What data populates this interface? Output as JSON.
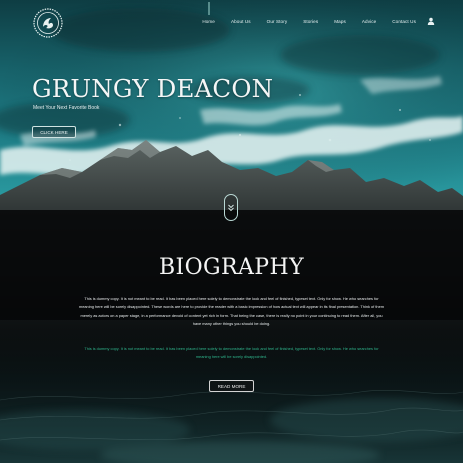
{
  "nav": {
    "items": [
      {
        "label": "Home",
        "active": true
      },
      {
        "label": "About Us"
      },
      {
        "label": "Our Story"
      },
      {
        "label": "Stories"
      },
      {
        "label": "Maps"
      },
      {
        "label": "Advice"
      },
      {
        "label": "Contact Us"
      }
    ],
    "user_icon": "user-icon"
  },
  "hero": {
    "title": "GRUNGY DEACON",
    "subtitle": "Meet Your Next Favorite Book",
    "button_label": "CLICK HERE"
  },
  "scroll_icon": "double-chevron-down-icon",
  "biography": {
    "title": "BIOGRAPHY",
    "paragraph1": "This is dummy copy. It is not meant to be read. It has been placed here solely to demonstrate the look and feel of finished, typeset text. Only for show. He who searches for meaning here will be sorely disappointed. These words are here to provide the reader with a basic impression of how actual text will appear in its final presentation. Think of them merely as actors on a paper stage, in a performance devoid of content yet rich in form. That being the case, there is really no point in your continuing to read them. After all, you have many other things you should be doing.",
    "paragraph2": "This is dummy copy. It is not meant to be read. It has been placed here solely to demonstrate the look and feel of finished, typeset text. Only for show. He who searches for meaning here will be sorely disappointed.",
    "button_label": "READ MORE"
  },
  "colors": {
    "accent_green": "#2fb58c",
    "ocean_teal": "#1f7d85",
    "dark": "#07090a"
  }
}
